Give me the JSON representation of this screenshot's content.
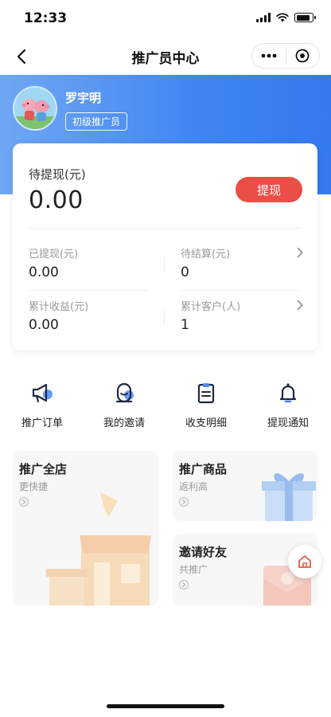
{
  "status_bar": {
    "time": "12:33"
  },
  "nav": {
    "title": "推广员中心"
  },
  "user": {
    "name": "罗宇明",
    "level": "初级推广员"
  },
  "wallet": {
    "pending_label": "待提现(元)",
    "pending_value": "0.00",
    "withdraw_label": "提现",
    "stats": [
      {
        "label": "已提现(元)",
        "value": "0.00"
      },
      {
        "label": "待结算(元)",
        "value": "0"
      },
      {
        "label": "累计收益(元)",
        "value": "0.00"
      },
      {
        "label": "累计客户(人)",
        "value": "1"
      }
    ]
  },
  "menu": [
    {
      "label": "推广订单",
      "icon": "megaphone-icon"
    },
    {
      "label": "我的邀请",
      "icon": "user-badge-icon"
    },
    {
      "label": "收支明细",
      "icon": "clipboard-icon"
    },
    {
      "label": "提现通知",
      "icon": "bell-icon"
    }
  ],
  "promos": {
    "store": {
      "title": "推广全店",
      "subtitle": "更快捷"
    },
    "goods": {
      "title": "推广商品",
      "subtitle": "返利高"
    },
    "invite": {
      "title": "邀请好友",
      "subtitle": "共推广"
    }
  },
  "colors": {
    "accent_blue": "#3f86f2",
    "withdraw_red": "#e94e47",
    "icon_dark": "#1f2a44",
    "icon_accent": "#4b8af5"
  }
}
